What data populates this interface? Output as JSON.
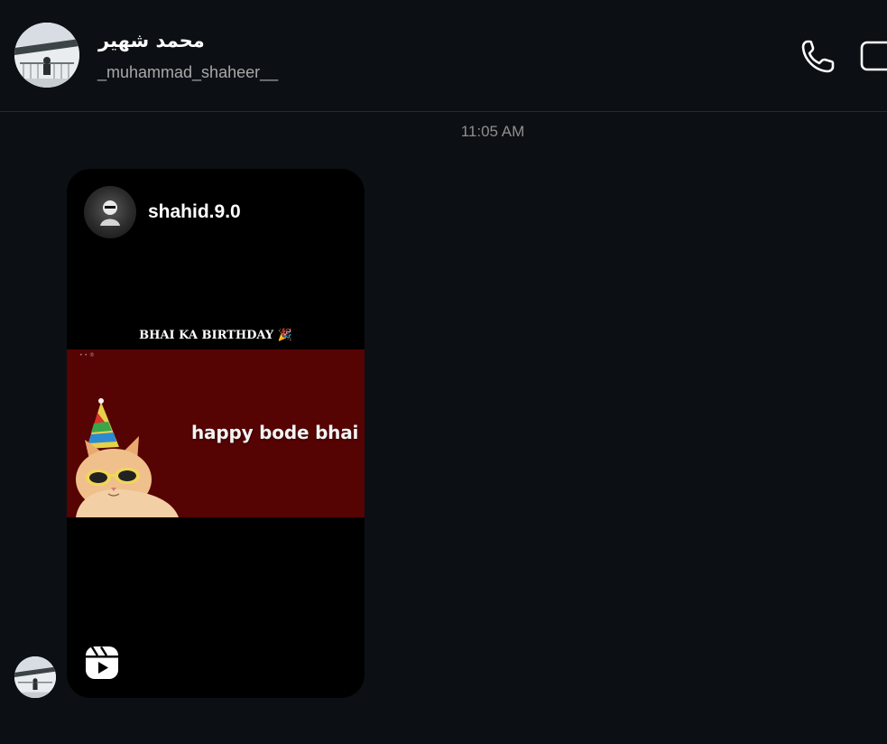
{
  "header": {
    "name": "محمد شهیر",
    "username": "_muhammad_shaheer__",
    "icons": [
      "avatar",
      "phone-icon",
      "video-call-icon"
    ]
  },
  "conversation": {
    "timestamp": "11:05 AM",
    "shared_reel": {
      "author": "shahid.9.0",
      "caption": "BHAI KA BIRTHDAY 🎉",
      "thumbnail_text": "happy bode bhai",
      "thumbnail_mark": "• • ®",
      "icon": "reels-icon"
    }
  },
  "colors": {
    "background": "#0c1014",
    "card": "#000000",
    "thumbnail_bg": "#560303",
    "muted_text": "#a8a8a8"
  }
}
